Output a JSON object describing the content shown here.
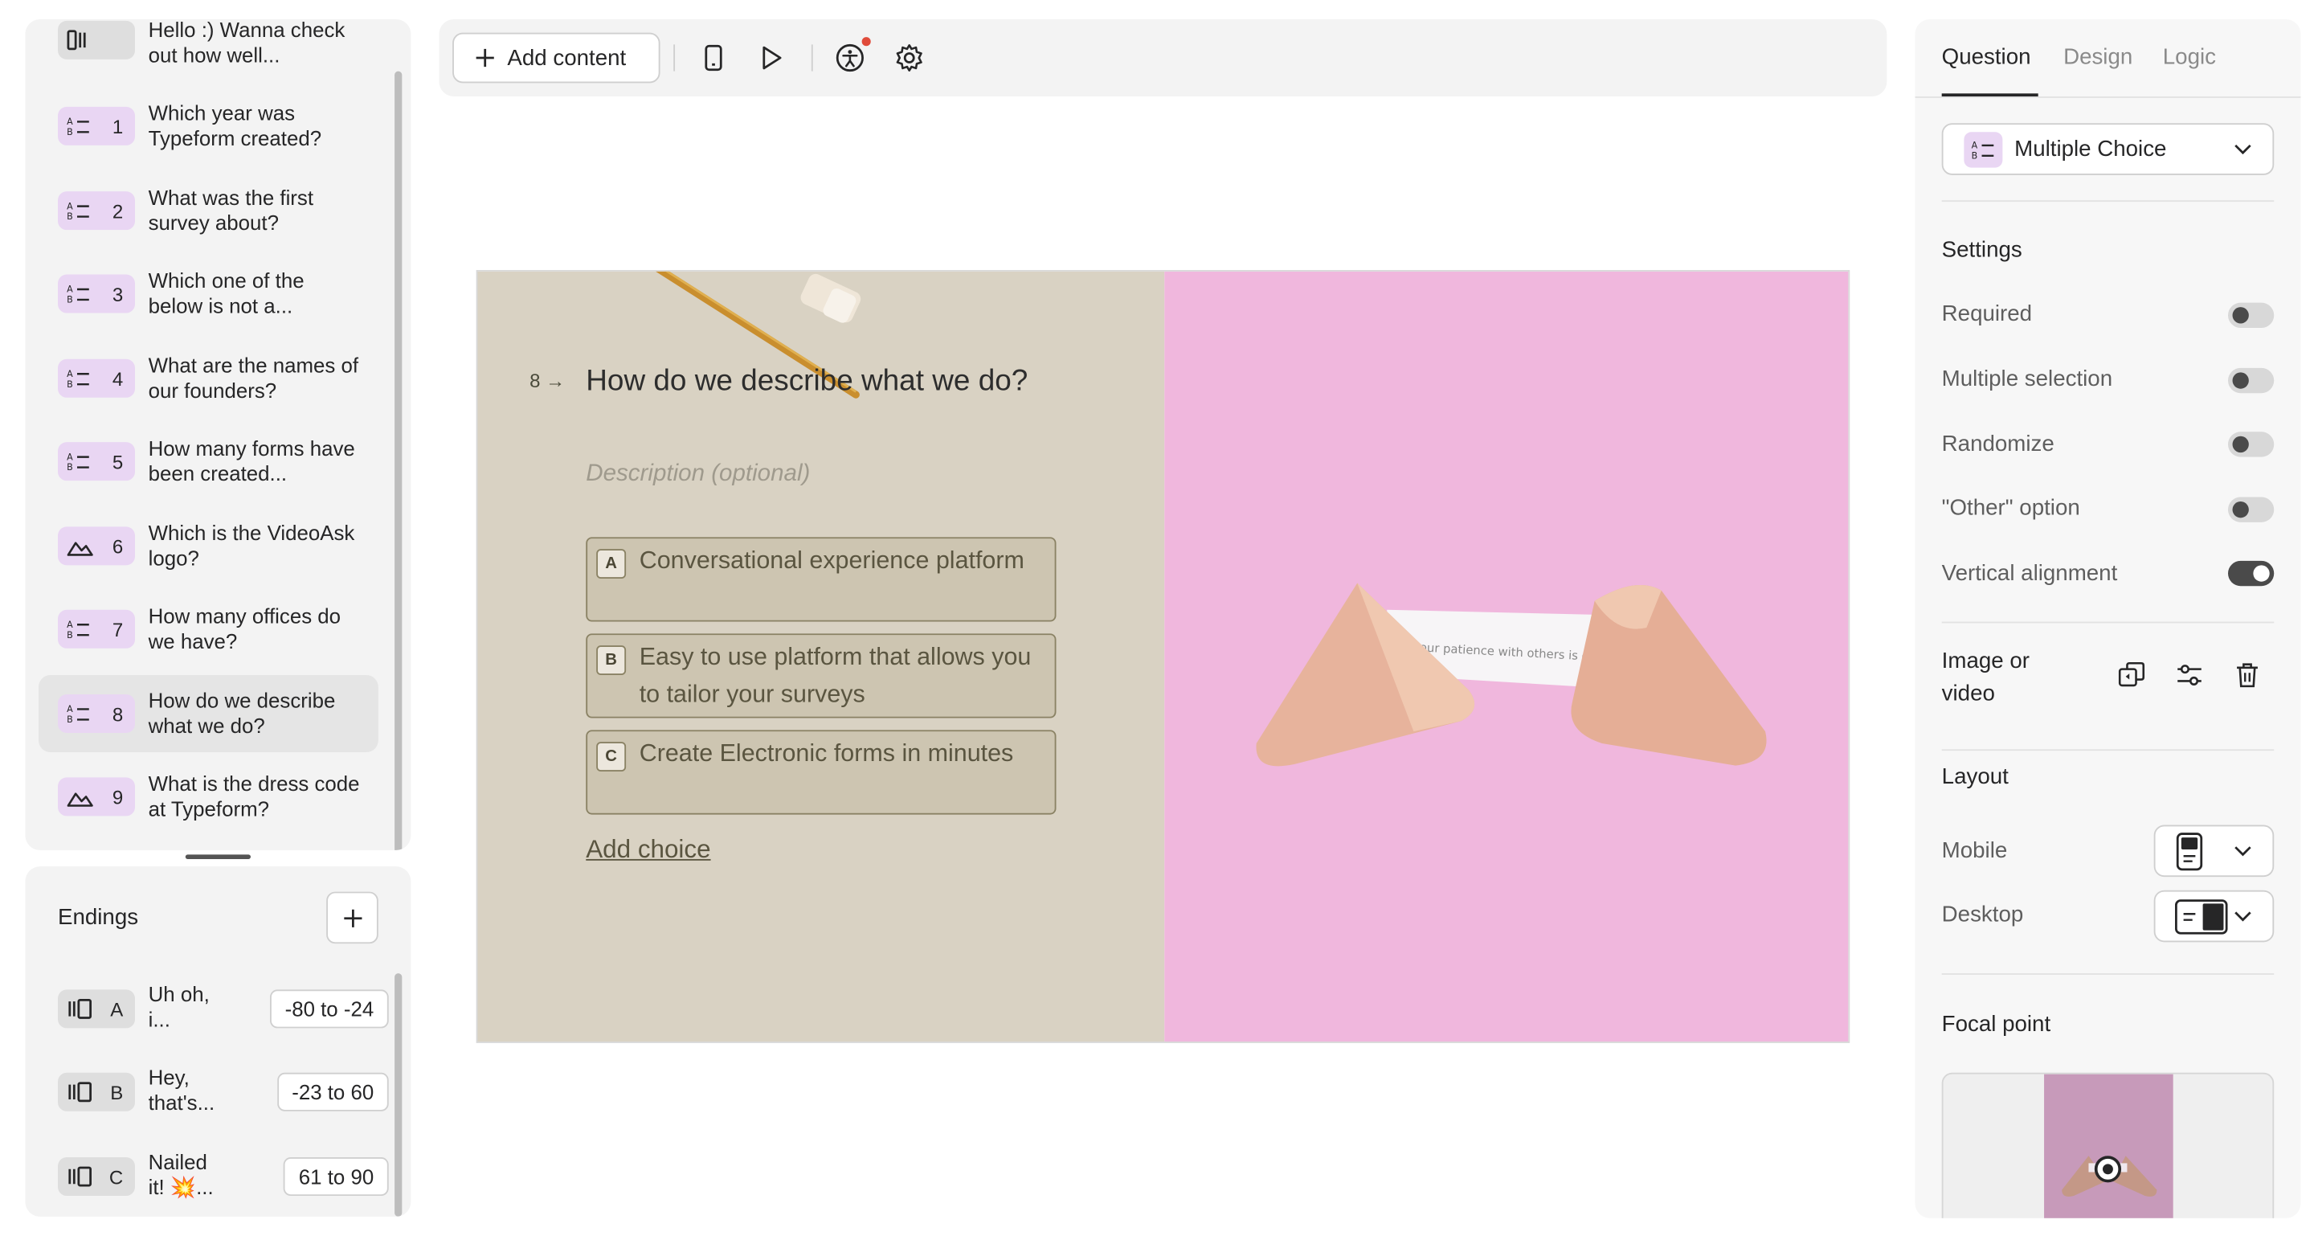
{
  "questions": [
    {
      "num": "",
      "type": "statement",
      "text": "Hello :) Wanna check out how well..."
    },
    {
      "num": "1",
      "type": "multiple-choice",
      "text": "Which year was Typeform created?"
    },
    {
      "num": "2",
      "type": "multiple-choice",
      "text": "What was the first survey about?"
    },
    {
      "num": "3",
      "type": "multiple-choice",
      "text": "Which one of the below is not a..."
    },
    {
      "num": "4",
      "type": "multiple-choice",
      "text": "What are the names of our founders?"
    },
    {
      "num": "5",
      "type": "multiple-choice",
      "text": "How many forms have been created..."
    },
    {
      "num": "6",
      "type": "picture-choice",
      "text": "Which is the VideoAsk logo?"
    },
    {
      "num": "7",
      "type": "multiple-choice",
      "text": "How many offices do we have?"
    },
    {
      "num": "8",
      "type": "multiple-choice",
      "text": "How do we describe what we do?"
    },
    {
      "num": "9",
      "type": "picture-choice",
      "text": "What is the dress code at Typeform?"
    }
  ],
  "endings": {
    "title": "Endings",
    "items": [
      {
        "key": "A",
        "text": "Uh oh, i...",
        "range": "-80 to -24"
      },
      {
        "key": "B",
        "text": "Hey, that's...",
        "range": "-23 to 60"
      },
      {
        "key": "C",
        "text": "Nailed it! 💥...",
        "range": "61 to 90"
      }
    ]
  },
  "toolbar": {
    "add_content": "Add content"
  },
  "canvas": {
    "number": "8",
    "title": "How do we describe what we do?",
    "description_placeholder": "Description (optional)",
    "choices": [
      {
        "key": "A",
        "label": "Conversational experience platform"
      },
      {
        "key": "B",
        "label": "Easy to use platform that allows you to tailor your surveys"
      },
      {
        "key": "C",
        "label": "Create Electronic forms in minutes"
      }
    ],
    "add_choice": "Add choice",
    "fortune_text": "our patience with others is good."
  },
  "right_panel": {
    "tabs": [
      "Question",
      "Design",
      "Logic"
    ],
    "question_type": "Multiple Choice",
    "settings_title": "Settings",
    "settings": [
      {
        "label": "Required",
        "on": false
      },
      {
        "label": "Multiple selection",
        "on": false
      },
      {
        "label": "Randomize",
        "on": false
      },
      {
        "label": "\"Other\" option",
        "on": false
      },
      {
        "label": "Vertical alignment",
        "on": true
      }
    ],
    "image_or_video": "Image or video",
    "layout_title": "Layout",
    "mobile_label": "Mobile",
    "desktop_label": "Desktop",
    "focal_title": "Focal point"
  },
  "colors": {
    "canvas_left": "#d9d2c3",
    "canvas_right": "#f0b7dd",
    "badge_purple": "#e9d6f3"
  }
}
